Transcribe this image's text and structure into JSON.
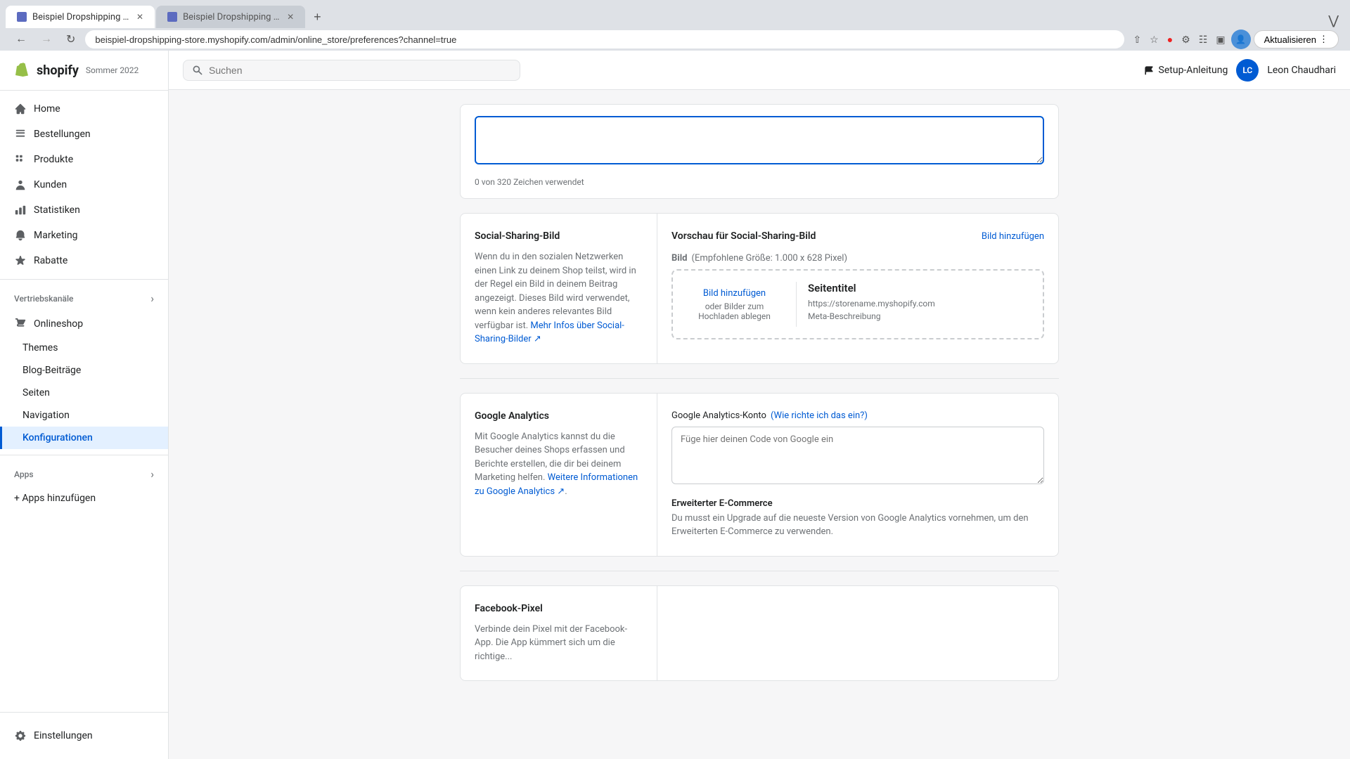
{
  "browser": {
    "tabs": [
      {
        "id": "tab1",
        "title": "Beispiel Dropshipping Store",
        "active": true,
        "favicon": true
      },
      {
        "id": "tab2",
        "title": "Beispiel Dropshipping Store",
        "active": false,
        "favicon": true
      }
    ],
    "address": "beispiel-dropshipping-store.myshopify.com/admin/online_store/preferences?channel=true",
    "update_button": "Aktualisieren"
  },
  "topbar": {
    "search_placeholder": "Suchen",
    "setup_label": "Setup-Anleitung",
    "user_initials": "LC",
    "user_name": "Leon Chaudhari"
  },
  "sidebar": {
    "logo": "shopify",
    "season": "Sommer 2022",
    "nav_items": [
      {
        "id": "home",
        "label": "Home",
        "icon": "home"
      },
      {
        "id": "orders",
        "label": "Bestellungen",
        "icon": "orders"
      },
      {
        "id": "products",
        "label": "Produkte",
        "icon": "products"
      },
      {
        "id": "customers",
        "label": "Kunden",
        "icon": "customers"
      },
      {
        "id": "analytics",
        "label": "Statistiken",
        "icon": "analytics"
      },
      {
        "id": "marketing",
        "label": "Marketing",
        "icon": "marketing"
      },
      {
        "id": "discounts",
        "label": "Rabatte",
        "icon": "discounts"
      }
    ],
    "sales_channels_label": "Vertriebskanäle",
    "online_store": "Onlineshop",
    "sub_items": [
      {
        "id": "themes",
        "label": "Themes",
        "active": false
      },
      {
        "id": "blog",
        "label": "Blog-Beiträge",
        "active": false
      },
      {
        "id": "pages",
        "label": "Seiten",
        "active": false
      },
      {
        "id": "navigation",
        "label": "Navigation",
        "active": false
      },
      {
        "id": "konfigurationen",
        "label": "Konfigurationen",
        "active": true
      }
    ],
    "apps_label": "Apps",
    "apps_add": "+ Apps hinzufügen",
    "settings_label": "Einstellungen"
  },
  "main": {
    "sections": [
      {
        "id": "char-count-section",
        "char_count": "0 von 320 Zeichen verwendet"
      },
      {
        "id": "social-sharing",
        "left_title": "Social-Sharing-Bild",
        "left_desc": "Wenn du in den sozialen Netzwerken einen Link zu deinem Shop teilst, wird in der Regel ein Bild in deinem Beitrag angezeigt. Dieses Bild wird verwendet, wenn kein anderes relevantes Bild verfügbar ist.",
        "left_link": "Mehr Infos über Social-Sharing-Bilder",
        "right_title": "Vorschau für Social-Sharing-Bild",
        "add_image_link": "Bild hinzufügen",
        "image_label": "Bild",
        "image_hint": "(Empfohlene Größe: 1.000 x 628 Pixel)",
        "upload_btn": "Bild hinzufügen",
        "upload_hint": "oder Bilder zum Hochladen ablegen",
        "preview_site_title": "Seitentitel",
        "preview_url": "https://storename.myshopify.com",
        "preview_description": "Meta-Beschreibung"
      },
      {
        "id": "google-analytics",
        "left_title": "Google Analytics",
        "left_desc": "Mit Google Analytics kannst du die Besucher deines Shops erfassen und Berichte erstellen, die dir bei deinem Marketing helfen.",
        "left_link": "Weitere Informationen zu Google Analytics",
        "right_label": "Google Analytics-Konto",
        "right_link": "Wie richte ich das ein?",
        "textarea_placeholder": "Füge hier deinen Code von Google ein",
        "ecommerce_title": "Erweiterter E-Commerce",
        "ecommerce_desc": "Du musst ein Upgrade auf die neueste Version von Google Analytics vornehmen, um den Erweiterten E-Commerce zu verwenden."
      },
      {
        "id": "facebook-pixel",
        "left_title": "Facebook-Pixel",
        "left_desc": "Verbinde dein Pixel mit der Facebook-App. Die App kümmert sich um die richtige..."
      }
    ]
  }
}
